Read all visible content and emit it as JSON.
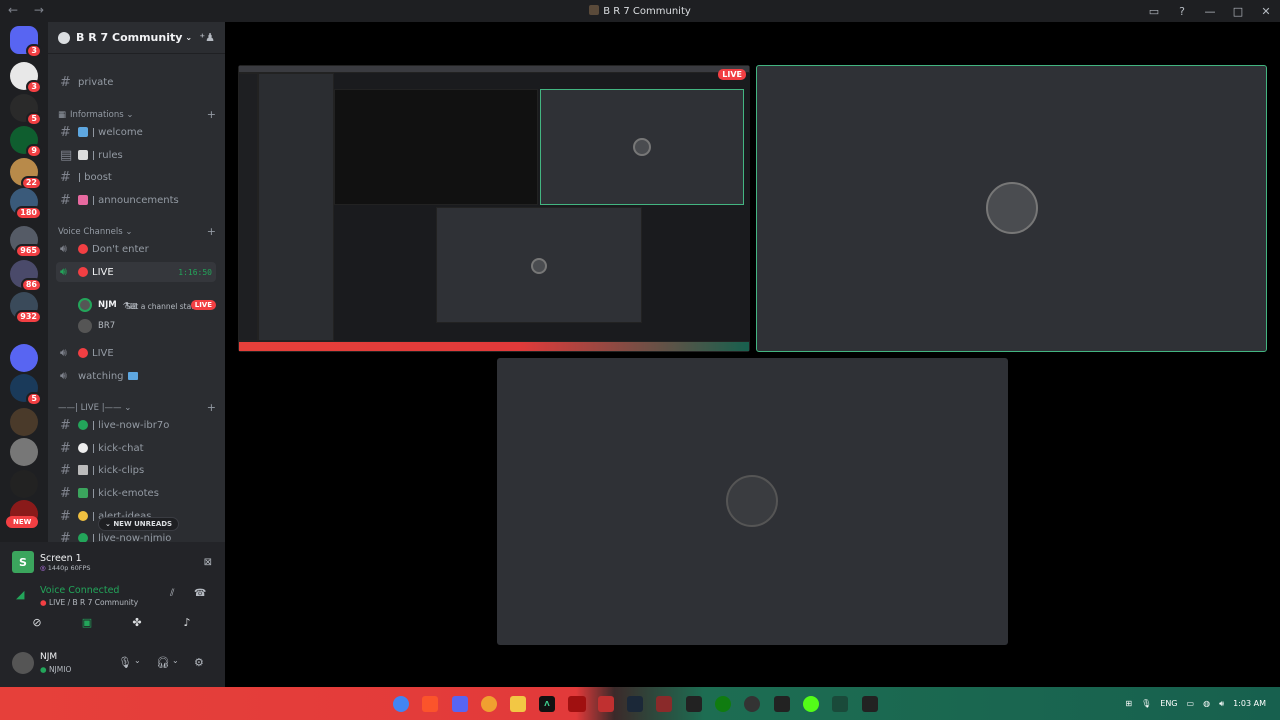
{
  "window": {
    "title": "B R 7 Community"
  },
  "servers": [
    {
      "name": "discord-home",
      "badge": "3",
      "color": "#5865f2"
    },
    {
      "name": "server-lsh",
      "badge": "3",
      "color": "#e8e8e8"
    },
    {
      "name": "server-oan",
      "badge": "5",
      "color": "#2a2a2a"
    },
    {
      "name": "server-fc",
      "badge": "9",
      "color": "#0f5e2f"
    },
    {
      "name": "server-4",
      "badge": "22",
      "color": "#b88a4a"
    },
    {
      "name": "server-5",
      "badge": "180",
      "color": "#3a5a7a"
    },
    {
      "name": "server-6",
      "badge": "965",
      "color": "#555b66"
    },
    {
      "name": "server-7",
      "badge": "86",
      "color": "#4a4a6a"
    },
    {
      "name": "server-8",
      "badge": "932",
      "color": "#3a4a5a"
    },
    {
      "name": "folder",
      "badge": "",
      "color": "#5865f2"
    },
    {
      "name": "server-v",
      "badge": "5",
      "color": "#1a3a5a"
    },
    {
      "name": "server-br7",
      "badge": "",
      "color": "#4a3a2a"
    },
    {
      "name": "server-11",
      "badge": "",
      "color": "#777"
    },
    {
      "name": "server-12",
      "badge": "",
      "color": "#222"
    },
    {
      "name": "server-13",
      "badge": "",
      "color": "#8a1a1a"
    }
  ],
  "new_pill": "NEW",
  "guild": {
    "name": "B R 7 Community"
  },
  "channels": {
    "private": "private",
    "cat_info": "Informations",
    "welcome": "welcome",
    "rules": "rules",
    "boost": "boost",
    "announcements": "announcements",
    "cat_voice": "Voice Channels",
    "dont_enter": "Don't enter",
    "live": "LIVE",
    "live_time": "1:16:50",
    "set_status": "Set a channel status",
    "user1": "NJM",
    "user1_badge": "LIVE",
    "user2": "BR7",
    "live2": "LIVE",
    "watching": "watching",
    "cat_live": "——| LIVE |——",
    "live_now": "live-now-ibr7o",
    "kick_chat": "kick-chat",
    "kick_clips": "kick-clips",
    "kick_emotes": "kick-emotes",
    "alert_ideas": "alert-ideas",
    "live_now2": "live-now-njmio"
  },
  "unreads": "NEW UNREADS",
  "screen": {
    "title": "Screen 1",
    "quality": "1440p 60FPS"
  },
  "voice": {
    "status": "Voice Connected",
    "location": "LIVE / B R 7 Community"
  },
  "user": {
    "display": "NJM",
    "username": "NJMIO"
  },
  "stream": {
    "live_badge": "LIVE"
  },
  "tray": {
    "lang": "ENG",
    "time": "1:03 AM"
  },
  "colors": {
    "accent": "#5865f2",
    "live": "#f23f43",
    "connected": "#23a55a"
  }
}
